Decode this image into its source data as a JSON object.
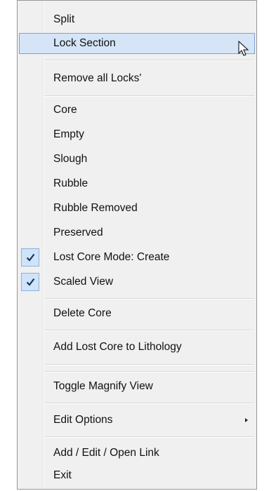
{
  "menu": {
    "items": [
      {
        "label": "Split"
      },
      {
        "label": "Lock Section"
      },
      {
        "label": "Remove all Locks'"
      },
      {
        "label": "Core"
      },
      {
        "label": "Empty"
      },
      {
        "label": "Slough"
      },
      {
        "label": "Rubble"
      },
      {
        "label": "Rubble Removed"
      },
      {
        "label": "Preserved"
      },
      {
        "label": "Lost Core Mode: Create",
        "checked": true
      },
      {
        "label": "Scaled View",
        "checked": true
      },
      {
        "label": "Delete Core"
      },
      {
        "label": "Add Lost Core to Lithology"
      },
      {
        "label": "Toggle Magnify View"
      },
      {
        "label": "Edit Options",
        "submenu": true
      },
      {
        "label": "Add / Edit / Open Link"
      },
      {
        "label": "Exit"
      }
    ]
  },
  "colors": {
    "hover_bg": "#d5e5f7",
    "hover_border": "#7da2ce",
    "check_bg": "#cfe3fa"
  }
}
